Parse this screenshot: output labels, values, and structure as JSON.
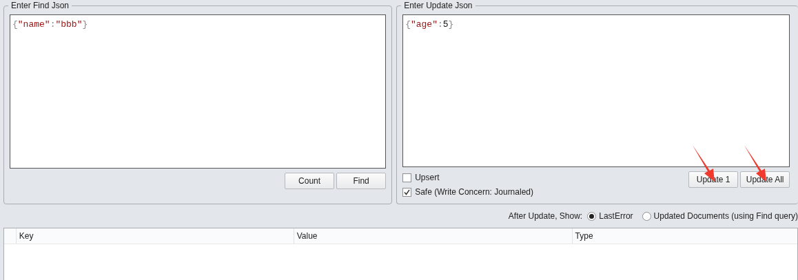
{
  "find_panel": {
    "title": "Enter Find Json",
    "editor_tokens": [
      {
        "kind": "punct",
        "text": "{"
      },
      {
        "kind": "string",
        "text": "\"name\""
      },
      {
        "kind": "punct",
        "text": ":"
      },
      {
        "kind": "string",
        "text": "\"bbb\""
      },
      {
        "kind": "punct",
        "text": "}"
      }
    ],
    "buttons": [
      {
        "label": "Count"
      },
      {
        "label": "Find"
      }
    ]
  },
  "update_panel": {
    "title": "Enter Update Json",
    "editor_tokens": [
      {
        "kind": "punct",
        "text": "{"
      },
      {
        "kind": "string",
        "text": "\"age\""
      },
      {
        "kind": "punct",
        "text": ":"
      },
      {
        "kind": "number",
        "text": "5"
      },
      {
        "kind": "punct",
        "text": "}"
      }
    ],
    "options": [
      {
        "label": "Upsert",
        "checked": false
      },
      {
        "label": "Safe (Write Concern: Journaled)",
        "checked": true
      }
    ],
    "buttons": [
      {
        "label": "Update 1",
        "arrow": true
      },
      {
        "label": "Update All",
        "arrow": true
      }
    ]
  },
  "after_update": {
    "label": "After Update, Show:",
    "choices": [
      {
        "label": "LastError",
        "selected": true
      },
      {
        "label": "Updated Documents (using Find query)",
        "selected": false
      }
    ]
  },
  "table": {
    "columns": [
      "Key",
      "Value",
      "Type"
    ]
  }
}
